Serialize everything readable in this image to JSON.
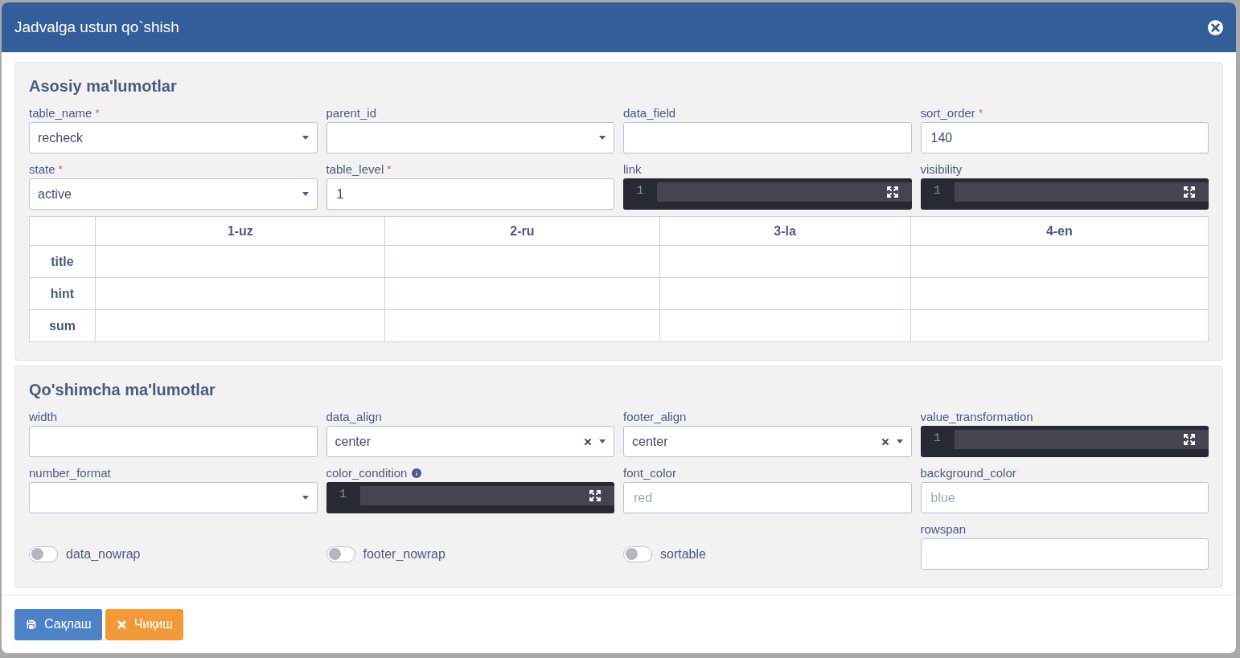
{
  "dialog": {
    "title": "Jadvalga ustun qo`shish"
  },
  "sections": [
    {
      "title": "Asosiy ma'lumotlar",
      "fields": [
        {
          "kind": "select",
          "label": "table_name",
          "required_mark": "*",
          "value": "recheck"
        },
        {
          "kind": "select",
          "label": "parent_id"
        },
        {
          "kind": "input",
          "label": "data_field"
        },
        {
          "kind": "input",
          "label": "sort_order",
          "required_mark": "*",
          "value": "140"
        },
        {
          "kind": "select",
          "label": "state",
          "required_mark": "*",
          "value": "active"
        },
        {
          "kind": "input",
          "label": "table_level",
          "required_mark": "*",
          "value": "1"
        },
        {
          "kind": "code",
          "label": "link",
          "line": "1"
        },
        {
          "kind": "code",
          "label": "visibility",
          "line": "1"
        }
      ],
      "translations": {
        "columns": [
          "1-uz",
          "2-ru",
          "3-la",
          "4-en"
        ],
        "rows": [
          "title",
          "hint",
          "sum"
        ]
      }
    },
    {
      "title": "Qo'shimcha ma'lumotlar",
      "fields": [
        {
          "kind": "input",
          "label": "width"
        },
        {
          "kind": "select",
          "label": "data_align",
          "value": "center",
          "clearable": true
        },
        {
          "kind": "select",
          "label": "footer_align",
          "value": "center",
          "clearable": true
        },
        {
          "kind": "code",
          "label": "value_transformation",
          "line": "1"
        },
        {
          "kind": "select",
          "label": "number_format"
        },
        {
          "kind": "code",
          "label": "color_condition",
          "line": "1",
          "info": true
        },
        {
          "kind": "input",
          "label": "font_color",
          "placeholder": "red"
        },
        {
          "kind": "input",
          "label": "background_color",
          "placeholder": "blue"
        },
        {
          "kind": "toggle",
          "label": "data_nowrap",
          "on": false
        },
        {
          "kind": "toggle",
          "label": "footer_nowrap",
          "on": false
        },
        {
          "kind": "toggle",
          "label": "sortable",
          "on": false
        },
        {
          "kind": "input",
          "label": "rowspan"
        }
      ]
    }
  ],
  "buttons": [
    {
      "kind": "save",
      "label": "Сақлаш"
    },
    {
      "kind": "exit",
      "label": "Чиқиш"
    }
  ]
}
